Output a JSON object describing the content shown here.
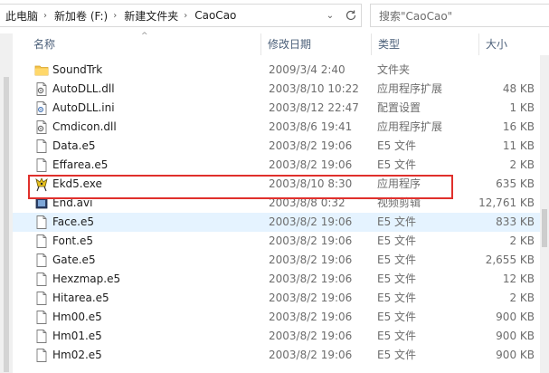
{
  "address": {
    "crumbs": [
      "此电脑",
      "新加卷 (F:)",
      "新建文件夹",
      "CaoCao"
    ]
  },
  "search": {
    "placeholder": "搜索\"CaoCao\""
  },
  "columns": {
    "name": "名称",
    "date": "修改日期",
    "type": "类型",
    "size": "大小"
  },
  "files": [
    {
      "name": "SoundTrk",
      "date": "2009/3/4 2:40",
      "type": "文件夹",
      "size": "",
      "icon": "folder-icon"
    },
    {
      "name": "AutoDLL.dll",
      "date": "2003/8/10 10:22",
      "type": "应用程序扩展",
      "size": "48 KB",
      "icon": "dll-file-icon"
    },
    {
      "name": "AutoDLL.ini",
      "date": "2003/8/12 22:47",
      "type": "配置设置",
      "size": "1 KB",
      "icon": "ini-file-icon"
    },
    {
      "name": "Cmdicon.dll",
      "date": "2003/8/6 19:41",
      "type": "应用程序扩展",
      "size": "16 KB",
      "icon": "dll-file-icon"
    },
    {
      "name": "Data.e5",
      "date": "2003/8/2 19:06",
      "type": "E5 文件",
      "size": "11 KB",
      "icon": "file-icon"
    },
    {
      "name": "Effarea.e5",
      "date": "2003/8/2 19:06",
      "type": "E5 文件",
      "size": "2 KB",
      "icon": "file-icon"
    },
    {
      "name": "Ekd5.exe",
      "date": "2003/8/10 8:30",
      "type": "应用程序",
      "size": "635 KB",
      "icon": "exe-app-icon"
    },
    {
      "name": "End.avi",
      "date": "2003/8/8 0:32",
      "type": "视频剪辑",
      "size": "12,761 KB",
      "icon": "video-file-icon"
    },
    {
      "name": "Face.e5",
      "date": "2003/8/2 19:06",
      "type": "E5 文件",
      "size": "833 KB",
      "icon": "file-icon"
    },
    {
      "name": "Font.e5",
      "date": "2003/8/2 19:06",
      "type": "E5 文件",
      "size": "2 KB",
      "icon": "file-icon"
    },
    {
      "name": "Gate.e5",
      "date": "2003/8/2 19:06",
      "type": "E5 文件",
      "size": "2,655 KB",
      "icon": "file-icon"
    },
    {
      "name": "Hexzmap.e5",
      "date": "2003/8/2 19:06",
      "type": "E5 文件",
      "size": "12 KB",
      "icon": "file-icon"
    },
    {
      "name": "Hitarea.e5",
      "date": "2003/8/2 19:06",
      "type": "E5 文件",
      "size": "2 KB",
      "icon": "file-icon"
    },
    {
      "name": "Hm00.e5",
      "date": "2003/8/2 19:06",
      "type": "E5 文件",
      "size": "900 KB",
      "icon": "file-icon"
    },
    {
      "name": "Hm01.e5",
      "date": "2003/8/2 19:06",
      "type": "E5 文件",
      "size": "900 KB",
      "icon": "file-icon"
    },
    {
      "name": "Hm02.e5",
      "date": "2003/8/2 19:06",
      "type": "E5 文件",
      "size": "900 KB",
      "icon": "file-icon"
    }
  ],
  "colors": {
    "highlight": "#e0302c",
    "hover_row": "#e5f3ff",
    "header_text": "#4c607a"
  }
}
